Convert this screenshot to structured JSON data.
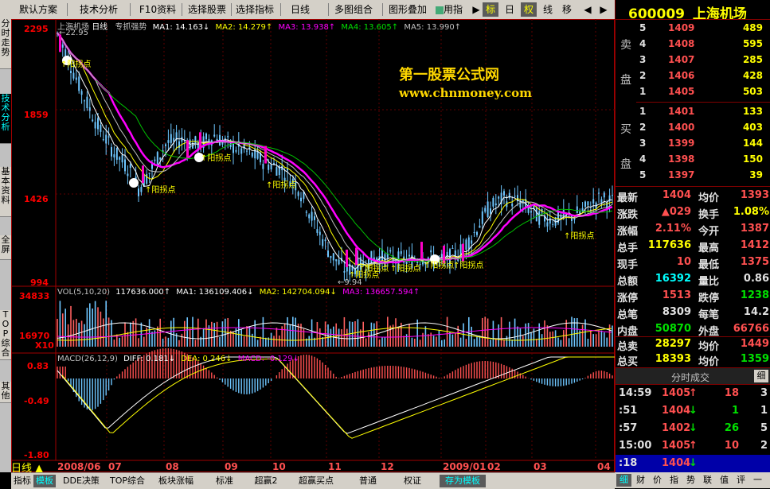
{
  "toolbar": {
    "items": [
      "默认方案",
      "技术分析",
      "F10资料",
      "选择股票",
      "选择指标",
      "日线",
      "多图组合",
      "图形叠加",
      "用指"
    ],
    "toggles": [
      "标",
      "日",
      "权",
      "线",
      "移"
    ]
  },
  "left_tabs": [
    "分时走势",
    "技术分析",
    "基本资料",
    "全屏",
    "TOP综合",
    "其他"
  ],
  "chart": {
    "stock_label": "上海机场",
    "period_label": "日线",
    "indicator_label": "专抓强势",
    "ma_line": {
      "ma1": "MA1: 14.163↓",
      "ma2": "MA2: 14.279↑",
      "ma3": "MA3: 13.938↑",
      "ma4": "MA4: 13.605↑",
      "ma5": "MA5: 13.990↑"
    },
    "price_axis": [
      "2295",
      "1859",
      "1426",
      "994"
    ],
    "high_note": "22.95",
    "low_note": "9.94",
    "watermark_title": "第一股票公式网",
    "watermark_url": "www.chnmoney.com",
    "signal_label": "阳拐点",
    "vol_line": {
      "name": "VOL(5,10,20)",
      "v": "117636.000↑",
      "ma1": "MA1: 136109.406↓",
      "ma2": "MA2: 142704.094↓",
      "ma3": "MA3: 136657.594↑"
    },
    "vol_axis": [
      "34833",
      "16970",
      "X10"
    ],
    "macd_line": {
      "name": "MACD(26,12,9)",
      "diff": "DIFF: 0.181↓",
      "dea": "DEA: 0.246↓",
      "macd": "MACD: -0.129↓"
    },
    "macd_axis": [
      "0.83",
      "-0.49",
      "-1.80"
    ],
    "date_axis": [
      "2008/06",
      "07",
      "08",
      "09",
      "10",
      "11",
      "12",
      "2009/01",
      "02",
      "03",
      "04"
    ],
    "period_button": "日线"
  },
  "bottom_tabs": [
    "指标",
    "模板",
    "DDE决策",
    "TOP综合",
    "板块涨幅",
    "标准",
    "超赢2",
    "超赢买点",
    "普通",
    "权证",
    "存为模板"
  ],
  "right_panel": {
    "code": "600009",
    "name": "上海机场",
    "sell_label": [
      "卖",
      "盘"
    ],
    "buy_label": [
      "买",
      "盘"
    ],
    "sells": [
      {
        "n": "5",
        "p": "1409",
        "v": "489"
      },
      {
        "n": "4",
        "p": "1408",
        "v": "595"
      },
      {
        "n": "3",
        "p": "1407",
        "v": "285"
      },
      {
        "n": "2",
        "p": "1406",
        "v": "428"
      },
      {
        "n": "1",
        "p": "1405",
        "v": "503"
      }
    ],
    "buys": [
      {
        "n": "1",
        "p": "1401",
        "v": "133"
      },
      {
        "n": "2",
        "p": "1400",
        "v": "403"
      },
      {
        "n": "3",
        "p": "1399",
        "v": "144"
      },
      {
        "n": "4",
        "p": "1398",
        "v": "150"
      },
      {
        "n": "5",
        "p": "1397",
        "v": "39"
      }
    ],
    "stats": [
      {
        "l": "最新",
        "v": "1404",
        "l2": "均价",
        "v2": "1393"
      },
      {
        "l": "涨跌",
        "v": "▲029",
        "l2": "换手",
        "v2": "1.08%"
      },
      {
        "l": "涨幅",
        "v": "2.11%",
        "l2": "今开",
        "v2": "1387"
      },
      {
        "l": "总手",
        "v": "117636",
        "l2": "最高",
        "v2": "1412"
      },
      {
        "l": "现手",
        "v": "10",
        "l2": "最低",
        "v2": "1375"
      },
      {
        "l": "总额",
        "v": "16392",
        "l2": "量比",
        "v2": "0.86"
      },
      {
        "l": "涨停",
        "v": "1513",
        "l2": "跌停",
        "v2": "1238"
      },
      {
        "l": "总笔",
        "v": "8309",
        "l2": "每笔",
        "v2": "14.2"
      },
      {
        "l": "内盘",
        "v": "50870",
        "l2": "外盘",
        "v2": "66766"
      }
    ],
    "totals": [
      {
        "l": "总卖",
        "v": "28297",
        "l2": "均价",
        "v2": "1449"
      },
      {
        "l": "总买",
        "v": "18393",
        "l2": "均价",
        "v2": "1359"
      }
    ],
    "ticks_title": "分时成交",
    "ticks_btn": "细",
    "ticks": [
      {
        "t": "14:59",
        "p": "1405",
        "d": "↑",
        "v": "18",
        "n": "3"
      },
      {
        "t": ":51",
        "p": "1404",
        "d": "↓",
        "v": "1",
        "n": "1"
      },
      {
        "t": ":57",
        "p": "1402",
        "d": "↓",
        "v": "26",
        "n": "5"
      },
      {
        "t": "15:00",
        "p": "1405",
        "d": "↑",
        "v": "10",
        "n": "2"
      },
      {
        "t": ":18",
        "p": "1404",
        "d": "↓",
        "v": "",
        "n": ""
      }
    ],
    "bottom_tabs": [
      "细",
      "财",
      "价",
      "指",
      "势",
      "联",
      "值",
      "评",
      "一"
    ]
  }
}
